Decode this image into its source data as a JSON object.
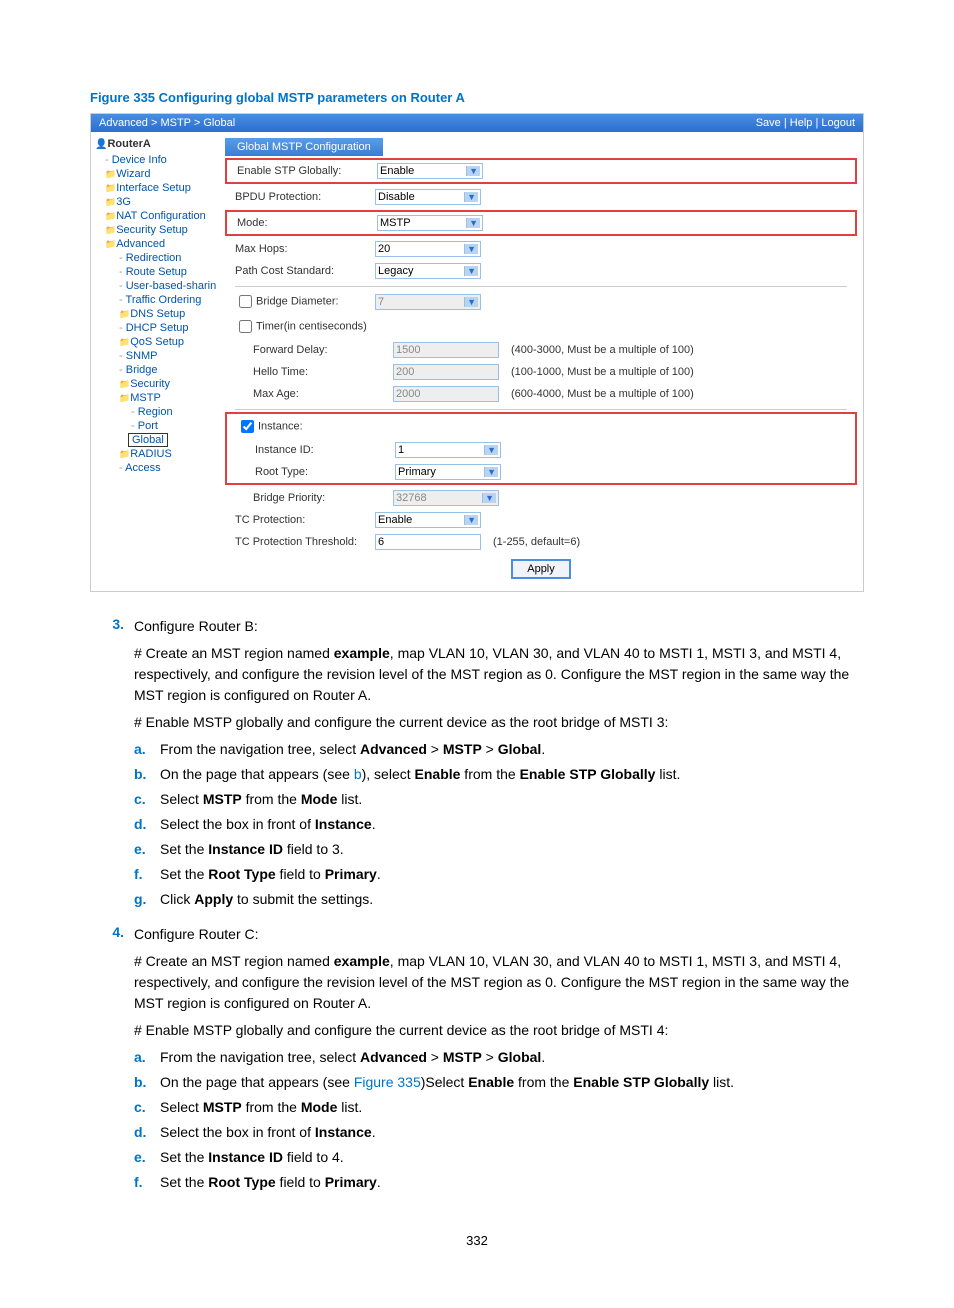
{
  "figure_caption": "Figure 335 Configuring global MSTP parameters on Router A",
  "breadcrumb": "Advanced > MSTP > Global",
  "topbar_links": "Save | Help | Logout",
  "device_name": "RouterA",
  "nav": {
    "device_info": "Device Info",
    "wizard": "Wizard",
    "interface_setup": "Interface Setup",
    "three_g": "3G",
    "nat_config": "NAT Configuration",
    "security_setup": "Security Setup",
    "advanced": "Advanced",
    "redirection": "Redirection",
    "route_setup": "Route Setup",
    "user_based_sharing": "User-based-sharin",
    "traffic_ordering": "Traffic Ordering",
    "dns_setup": "DNS Setup",
    "dhcp_setup": "DHCP Setup",
    "qos_setup": "QoS Setup",
    "snmp": "SNMP",
    "bridge": "Bridge",
    "security": "Security",
    "mstp": "MSTP",
    "region": "Region",
    "port": "Port",
    "global": "Global",
    "radius": "RADIUS",
    "access": "Access"
  },
  "tab_title": "Global MSTP Configuration",
  "form": {
    "enable_stp_label": "Enable STP Globally:",
    "enable_stp_value": "Enable",
    "bpdu_label": "BPDU Protection:",
    "bpdu_value": "Disable",
    "mode_label": "Mode:",
    "mode_value": "MSTP",
    "max_hops_label": "Max Hops:",
    "max_hops_value": "20",
    "path_cost_label": "Path Cost Standard:",
    "path_cost_value": "Legacy",
    "bridge_diameter_label": "Bridge Diameter:",
    "bridge_diameter_value": "7",
    "timer_label": "Timer(in centiseconds)",
    "forward_delay_label": "Forward Delay:",
    "forward_delay_value": "1500",
    "forward_delay_hint": "(400-3000, Must be a multiple of 100)",
    "hello_time_label": "Hello Time:",
    "hello_time_value": "200",
    "hello_time_hint": "(100-1000, Must be a multiple of 100)",
    "max_age_label": "Max Age:",
    "max_age_value": "2000",
    "max_age_hint": "(600-4000, Must be a multiple of 100)",
    "instance_label": "Instance:",
    "instance_id_label": "Instance ID:",
    "instance_id_value": "1",
    "root_type_label": "Root Type:",
    "root_type_value": "Primary",
    "bridge_priority_label": "Bridge Priority:",
    "bridge_priority_value": "32768",
    "tc_protection_label": "TC Protection:",
    "tc_protection_value": "Enable",
    "tc_threshold_label": "TC Protection Threshold:",
    "tc_threshold_value": "6",
    "tc_threshold_hint": "(1-255, default=6)",
    "apply_label": "Apply"
  },
  "steps": {
    "s3": {
      "num": "3.",
      "title": "Configure Router B:",
      "p1_a": "# Create an MST region named ",
      "p1_b": "example",
      "p1_c": ", map VLAN 10, VLAN 30, and VLAN 40 to MSTI 1, MSTI 3, and MSTI 4, respectively, and configure the revision level of the MST region as 0. Configure the MST region in the same way the MST region is configured on Router A.",
      "p2": "# Enable MSTP globally and configure the current device as the root bridge of MSTI 3:",
      "a": {
        "l": "a.",
        "t1": "From the navigation tree, select ",
        "b1": "Advanced",
        "sep1": " > ",
        "b2": "MSTP",
        "sep2": " > ",
        "b3": "Global",
        "t2": "."
      },
      "b": {
        "l": "b.",
        "t1": "On the page that appears (see ",
        "link": "b",
        "t2": "), select ",
        "b1": "Enable",
        "t3": " from the ",
        "b2": "Enable STP Globally",
        "t4": " list."
      },
      "c": {
        "l": "c.",
        "t1": "Select ",
        "b1": "MSTP",
        "t2": " from the ",
        "b2": "Mode",
        "t3": " list."
      },
      "d": {
        "l": "d.",
        "t1": "Select the box in front of ",
        "b1": "Instance",
        "t2": "."
      },
      "e": {
        "l": "e.",
        "t1": "Set the ",
        "b1": "Instance ID",
        "t2": " field to 3."
      },
      "f": {
        "l": "f.",
        "t1": "Set the ",
        "b1": "Root Type",
        "t2": " field to ",
        "b2": "Primary",
        "t3": "."
      },
      "g": {
        "l": "g.",
        "t1": "Click ",
        "b1": "Apply",
        "t2": " to submit the settings."
      }
    },
    "s4": {
      "num": "4.",
      "title": "Configure Router C:",
      "p1_a": "# Create an MST region named ",
      "p1_b": "example",
      "p1_c": ", map VLAN 10, VLAN 30, and VLAN 40 to MSTI 1, MSTI 3, and MSTI 4, respectively, and configure the revision level of the MST region as 0. Configure the MST region in the same way the MST region is configured on Router A.",
      "p2": "# Enable MSTP globally and configure the current device as the root bridge of MSTI 4:",
      "a": {
        "l": "a.",
        "t1": "From the navigation tree, select ",
        "b1": "Advanced",
        "sep1": " > ",
        "b2": "MSTP",
        "sep2": " > ",
        "b3": "Global",
        "t2": "."
      },
      "b": {
        "l": "b.",
        "t1": "On the page that appears (see ",
        "link": "Figure 335",
        "t2": ")Select ",
        "b1": "Enable",
        "t3": " from the ",
        "b2": "Enable STP Globally",
        "t4": " list."
      },
      "c": {
        "l": "c.",
        "t1": "Select ",
        "b1": "MSTP",
        "t2": " from the ",
        "b2": "Mode",
        "t3": " list."
      },
      "d": {
        "l": "d.",
        "t1": "Select the box in front of ",
        "b1": "Instance",
        "t2": "."
      },
      "e": {
        "l": "e.",
        "t1": "Set the ",
        "b1": "Instance ID",
        "t2": " field to 4."
      },
      "f": {
        "l": "f.",
        "t1": "Set the ",
        "b1": "Root Type",
        "t2": " field to ",
        "b2": "Primary",
        "t3": "."
      }
    }
  },
  "page_number": "332"
}
